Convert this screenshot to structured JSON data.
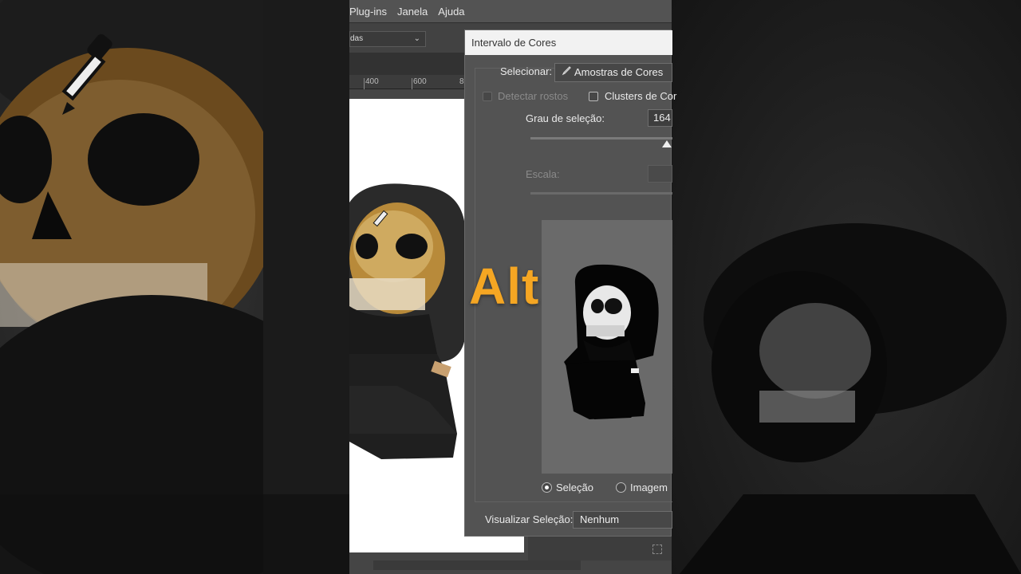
{
  "menubar": {
    "items": [
      "Plug-ins",
      "Janela",
      "Ajuda"
    ]
  },
  "options_bar": {
    "select_value": "das"
  },
  "ruler": {
    "marks": [
      "400",
      "600",
      "8"
    ]
  },
  "dialog": {
    "title": "Intervalo de Cores",
    "select_label": "Selecionar:",
    "select_value": "Amostras de Cores",
    "detect_faces_label": "Detectar rostos",
    "clusters_label": "Clusters de Cor",
    "fuzziness_label": "Grau de seleção:",
    "fuzziness_value": "164",
    "fuzziness_level": 0.95,
    "range_label": "Escala:",
    "radio_selection_label": "Seleção",
    "radio_image_label": "Imagem",
    "radio_selected": "Seleção",
    "preview_label": "Visualizar Seleção:",
    "preview_value": "Nenhum"
  },
  "overlay": {
    "text": "Alt",
    "color": "#f5a623"
  },
  "icons": [
    "eyedropper-icon",
    "grid-icon",
    "chevron-down-icon"
  ]
}
